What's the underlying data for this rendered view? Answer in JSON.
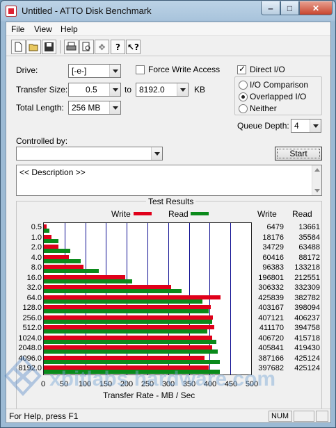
{
  "window": {
    "title": "Untitled - ATTO Disk Benchmark"
  },
  "menu": [
    "File",
    "View",
    "Help"
  ],
  "toolbar": {
    "icons": [
      "new-icon",
      "open-icon",
      "save-icon",
      "print-icon",
      "print-preview-icon",
      "move-icon",
      "help-icon",
      "context-help-icon"
    ]
  },
  "form": {
    "drive_label": "Drive:",
    "drive_value": "[-e-]",
    "force_write_label": "Force Write Access",
    "force_write_checked": false,
    "direct_io_label": "Direct I/O",
    "direct_io_checked": true,
    "transfer_size_label": "Transfer Size:",
    "transfer_from": "0.5",
    "to_label": "to",
    "transfer_to": "8192.0",
    "kb_label": "KB",
    "total_length_label": "Total Length:",
    "total_length_value": "256 MB",
    "io_options": [
      "I/O Comparison",
      "Overlapped I/O",
      "Neither"
    ],
    "io_selected": "Overlapped I/O",
    "queue_depth_label": "Queue Depth:",
    "queue_depth_value": "4",
    "controlled_by_label": "Controlled by:",
    "controlled_by_value": "",
    "start_label": "Start",
    "description": "<< Description >>"
  },
  "results": {
    "title": "Test Results",
    "legend_write": "Write",
    "legend_read": "Read",
    "col_write": "Write",
    "col_read": "Read",
    "xlabel": "Transfer Rate - MB / Sec",
    "xticks": [
      "0",
      "50",
      "100",
      "150",
      "200",
      "250",
      "300",
      "350",
      "400",
      "450",
      "500"
    ],
    "write_color": "#e0001a",
    "read_color": "#0a8a1a"
  },
  "chart_data": {
    "type": "bar",
    "title": "Test Results",
    "xlabel": "Transfer Rate - MB / Sec",
    "xlim": [
      0,
      500
    ],
    "legend": "top",
    "grid": true,
    "categories": [
      "0.5",
      "1.0",
      "2.0",
      "4.0",
      "8.0",
      "16.0",
      "32.0",
      "64.0",
      "128.0",
      "256.0",
      "512.0",
      "1024.0",
      "2048.0",
      "4096.0",
      "8192.0"
    ],
    "series": [
      {
        "name": "Write",
        "values": [
          6479,
          18176,
          34729,
          60416,
          96383,
          196801,
          306332,
          425839,
          403167,
          407121,
          411170,
          406720,
          405841,
          387166,
          397682
        ]
      },
      {
        "name": "Read",
        "values": [
          13661,
          35584,
          63488,
          88172,
          133218,
          212551,
          332309,
          382782,
          398094,
          406237,
          394758,
          415718,
          419430,
          425124,
          425124
        ]
      }
    ]
  },
  "status": {
    "help": "For Help, press F1",
    "num": "NUM"
  },
  "watermark": "xbitlabs hardware.com"
}
